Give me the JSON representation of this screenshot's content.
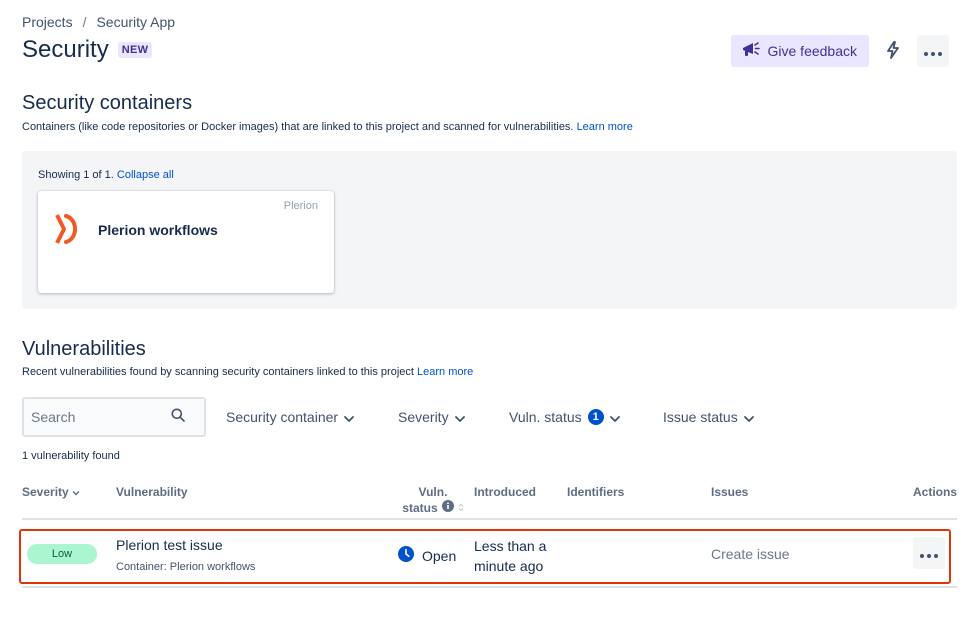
{
  "breadcrumb": {
    "items": [
      "Projects",
      "Security App"
    ],
    "separator": "/"
  },
  "page": {
    "title": "Security",
    "badge": "NEW"
  },
  "header_actions": {
    "feedback_label": "Give feedback"
  },
  "containers": {
    "title": "Security containers",
    "description": "Containers (like code repositories or Docker images) that are linked to this project and scanned for vulnerabilities.",
    "learn_more": "Learn more",
    "showing": "Showing 1 of 1.",
    "collapse_all": "Collapse all",
    "card": {
      "vendor": "Plerion",
      "name": "Plerion workflows",
      "logo_color": "#f15a24"
    }
  },
  "vulnerabilities": {
    "title": "Vulnerabilities",
    "description": "Recent vulnerabilities found by scanning security containers linked to this project",
    "learn_more": "Learn more",
    "search_placeholder": "Search",
    "filters": {
      "security_container": "Security container",
      "severity": "Severity",
      "vuln_status": "Vuln. status",
      "vuln_status_count": "1",
      "issue_status": "Issue status"
    },
    "found_text": "1 vulnerability found",
    "columns": {
      "severity": "Severity",
      "vulnerability": "Vulnerability",
      "vuln_status_line1": "Vuln.",
      "vuln_status_line2": "status",
      "introduced": "Introduced",
      "identifiers": "Identifiers",
      "issues": "Issues",
      "actions": "Actions"
    },
    "rows": [
      {
        "severity": "Low",
        "name": "Plerion test issue",
        "container": "Container: Plerion workflows",
        "status": "Open",
        "introduced": "Less than a minute ago",
        "identifiers": "",
        "issue_action": "Create issue"
      }
    ]
  },
  "colors": {
    "accent": "#0052cc",
    "highlight_border": "#de350b",
    "low_severity_bg": "#abf5d1",
    "feedback_bg": "#eae6ff"
  }
}
